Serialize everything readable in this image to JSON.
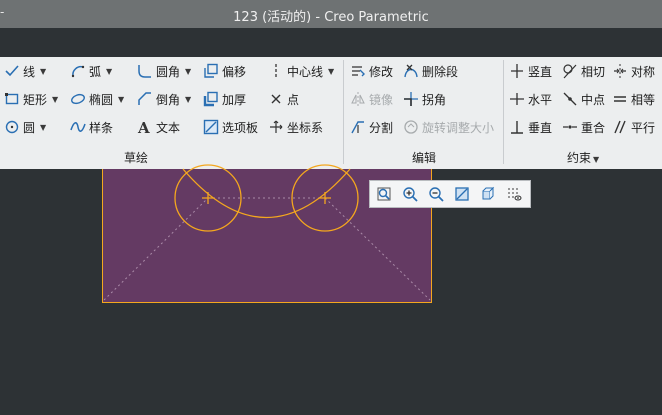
{
  "window": {
    "title": "123 (活动的) - Creo Parametric",
    "left_glyph": "-"
  },
  "colors": {
    "accent": "#2a6fb3",
    "sketch": "#f4a71e",
    "canvas": "#643a63",
    "background": "#2d3235"
  },
  "groups": {
    "sketch": {
      "label": "草绘",
      "items": {
        "line": "线",
        "arc": "弧",
        "fillet": "圆角",
        "offset": "偏移",
        "centerline": "中心线",
        "rectangle": "矩形",
        "ellipse": "椭圆",
        "chamfer": "倒角",
        "thicken": "加厚",
        "point": "点",
        "circle": "圆",
        "spline": "样条",
        "text": "文本",
        "palette": "选项板",
        "coordinate_system": "坐标系"
      }
    },
    "edit": {
      "label": "编辑",
      "items": {
        "modify": "修改",
        "delete_segment": "删除段",
        "mirror": "镜像",
        "corner": "拐角",
        "divide": "分割",
        "rotate_resize": "旋转调整大小"
      }
    },
    "constrain": {
      "label": "约束",
      "items": {
        "vertical": "竖直",
        "tangent": "相切",
        "symmetric": "对称",
        "horizontal": "水平",
        "midpoint": "中点",
        "equal": "相等",
        "perpendicular": "垂直",
        "coincident": "重合",
        "parallel": "平行"
      }
    }
  },
  "view_toolbar": {
    "icons": [
      "refit-icon",
      "zoom-in-icon",
      "zoom-out-icon",
      "repaint-icon",
      "saved-orientations-icon",
      "sketch-display-icon"
    ]
  }
}
